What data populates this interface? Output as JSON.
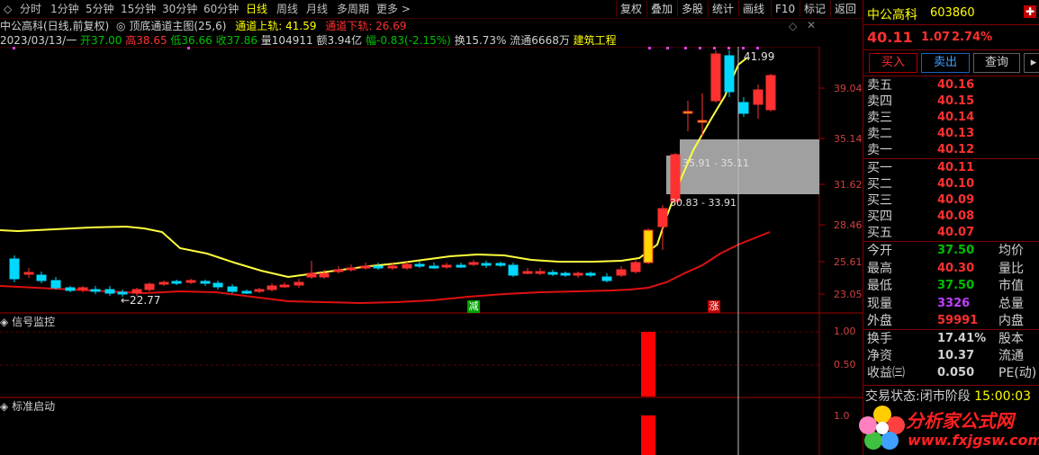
{
  "periods": [
    "分时",
    "1分钟",
    "5分钟",
    "15分钟",
    "30分钟",
    "60分钟",
    "日线",
    "周线",
    "月线",
    "多周期",
    "更多"
  ],
  "active_period": "日线",
  "toolbar": [
    "复权",
    "叠加",
    "多股",
    "统计",
    "画线",
    "F10",
    "标记",
    "返回"
  ],
  "info1": {
    "name": "中公高科(日线,前复权)",
    "indicator": "顶底通道主图(25,6)",
    "upper_label": "通道上轨: 41.59",
    "lower_label": "通道下轨: 26.69"
  },
  "info2": {
    "date": "2023/03/13/一",
    "open": "开37.00",
    "high": "高38.65",
    "low": "低36.66",
    "close": "收37.86",
    "vol": "量104911",
    "amount": "额3.94亿",
    "change": "幅-0.83(-2.15%)",
    "turnover": "换15.73%",
    "float": "流通6668万",
    "industry": "建筑工程"
  },
  "price_axis": [
    "39.04",
    "35.14",
    "31.62",
    "28.46",
    "25.61",
    "23.05"
  ],
  "annotations": {
    "high_label": "41.99",
    "low_label": "←22.77",
    "zone1": "35.91 - 35.11",
    "zone2": "30.83 - 33.91",
    "signal_jian": "减",
    "signal_zhang": "涨"
  },
  "panel1": {
    "title": "信号监控",
    "ticks": [
      "1.00",
      "0.50"
    ]
  },
  "panel2": {
    "title": "标准启动",
    "ticks": [
      "1.0"
    ]
  },
  "quote": {
    "name": "中公高科",
    "code": "603860",
    "price": "40.11",
    "change": "1.07",
    "pct": "2.74%",
    "buttons": [
      "买入",
      "卖出",
      "查询"
    ],
    "asks": [
      {
        "label": "卖五",
        "price": "40.16"
      },
      {
        "label": "卖四",
        "price": "40.15"
      },
      {
        "label": "卖三",
        "price": "40.14"
      },
      {
        "label": "卖二",
        "price": "40.13"
      },
      {
        "label": "卖一",
        "price": "40.12"
      }
    ],
    "bids": [
      {
        "label": "买一",
        "price": "40.11"
      },
      {
        "label": "买二",
        "price": "40.10"
      },
      {
        "label": "买三",
        "price": "40.09"
      },
      {
        "label": "买四",
        "price": "40.08"
      },
      {
        "label": "买五",
        "price": "40.07"
      }
    ],
    "stats": [
      {
        "l1": "今开",
        "v1": "37.50",
        "c1": "#00c000",
        "l2": "均价"
      },
      {
        "l1": "最高",
        "v1": "40.30",
        "c1": "#ff3030",
        "l2": "量比"
      },
      {
        "l1": "最低",
        "v1": "37.50",
        "c1": "#00c000",
        "l2": "市值"
      },
      {
        "l1": "现量",
        "v1": "3326",
        "c1": "#c040ff",
        "l2": "总量"
      },
      {
        "l1": "外盘",
        "v1": "59991",
        "c1": "#ff3030",
        "l2": "内盘"
      }
    ],
    "stats2": [
      {
        "l1": "换手",
        "v1": "17.41%",
        "l2": "股本"
      },
      {
        "l1": "净资",
        "v1": "10.37",
        "l2": "流通"
      },
      {
        "l1": "收益㈢",
        "v1": "0.050",
        "l2": "PE(动)"
      }
    ],
    "status_label": "交易状态:",
    "status_value": "闭市阶段",
    "status_time": "15:00:03"
  },
  "watermark": {
    "text": "分析家公式网",
    "url": "www.fxjgsw.com"
  },
  "colors": {
    "up": "#ff3030",
    "down": "#00d8ff",
    "upper_band": "#ffff40",
    "lower_band": "#e01010",
    "zone": "#a0a0a0",
    "bg": "#000000"
  }
}
